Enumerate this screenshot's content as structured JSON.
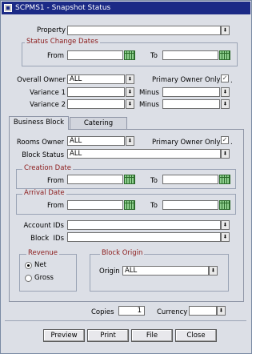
{
  "window": {
    "title": "SCPMS1 - Snapshot Status"
  },
  "property": {
    "label": "Property",
    "value": ""
  },
  "status_change_dates": {
    "title": "Status Change Dates",
    "from_label": "From",
    "from_value": "",
    "to_label": "To",
    "to_value": ""
  },
  "overall_owner": {
    "label": "Overall Owner",
    "value": "ALL"
  },
  "primary_owner_only_top": {
    "label": "Primary Owner Only",
    "checked": true
  },
  "variance1": {
    "label": "Variance 1",
    "value": "",
    "minus_label": "Minus",
    "minus_value": ""
  },
  "variance2": {
    "label": "Variance 2",
    "value": "",
    "minus_label": "Minus",
    "minus_value": ""
  },
  "tabs": [
    {
      "label": "Business Block",
      "active": true
    },
    {
      "label": "Catering",
      "active": false
    }
  ],
  "business_block": {
    "rooms_owner": {
      "label": "Rooms Owner",
      "value": "ALL"
    },
    "primary_owner_only": {
      "label": "Primary Owner Only",
      "checked": true
    },
    "block_status": {
      "label": "Block Status",
      "value": "ALL"
    },
    "creation_date": {
      "title": "Creation Date",
      "from_label": "From",
      "from_value": "",
      "to_label": "To",
      "to_value": ""
    },
    "arrival_date": {
      "title": "Arrival Date",
      "from_label": "From",
      "from_value": "",
      "to_label": "To",
      "to_value": ""
    },
    "account_ids": {
      "label": "Account IDs",
      "value": ""
    },
    "block_ids": {
      "label": "Block  IDs",
      "value": ""
    },
    "revenue": {
      "title": "Revenue",
      "options": [
        "Net",
        "Gross"
      ],
      "selected": "Net"
    },
    "block_origin": {
      "title": "Block Origin",
      "origin_label": "Origin",
      "origin_value": "ALL"
    }
  },
  "copies": {
    "label": "Copies",
    "value": "1"
  },
  "currency": {
    "label": "Currency",
    "value": ""
  },
  "buttons": {
    "preview": "Preview",
    "print": "Print",
    "file": "File",
    "close": "Close"
  }
}
